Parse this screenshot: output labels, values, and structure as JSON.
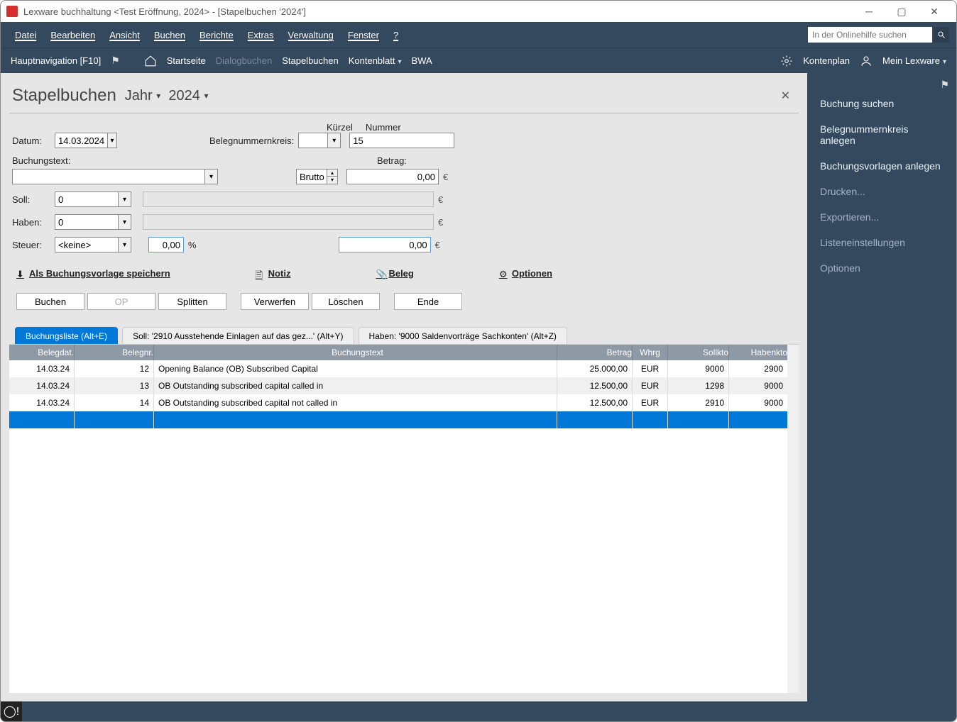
{
  "window": {
    "title": "Lexware buchhaltung <Test Eröffnung, 2024> - [Stapelbuchen '2024']"
  },
  "menubar": {
    "items": [
      "Datei",
      "Bearbeiten",
      "Ansicht",
      "Buchen",
      "Berichte",
      "Extras",
      "Verwaltung",
      "Fenster",
      "?"
    ],
    "search_placeholder": "In der Onlinehilfe suchen"
  },
  "navbar": {
    "hauptnav": "Hauptnavigation [F10]",
    "crumbs": [
      "Startseite",
      "Dialogbuchen",
      "Stapelbuchen",
      "Kontenblatt",
      "BWA"
    ],
    "kontenplan": "Kontenplan",
    "mein": "Mein Lexware"
  },
  "rightpanel": {
    "items": [
      {
        "t": "Buchung suchen",
        "dim": false
      },
      {
        "t": "Belegnummernkreis anlegen",
        "dim": false
      },
      {
        "t": "Buchungsvorlagen anlegen",
        "dim": false
      },
      {
        "t": "Drucken...",
        "dim": true
      },
      {
        "t": "Exportieren...",
        "dim": true
      },
      {
        "t": "Listeneinstellungen",
        "dim": true
      },
      {
        "t": "Optionen",
        "dim": true
      }
    ]
  },
  "page": {
    "title": "Stapelbuchen",
    "year_lbl": "Jahr",
    "year": "2024",
    "labels": {
      "datum": "Datum:",
      "belegnrkreis": "Belegnummernkreis:",
      "kuerzel": "Kürzel",
      "nummer": "Nummer",
      "buchungstext": "Buchungstext:",
      "betrag": "Betrag:",
      "brutto": "Brutto",
      "soll": "Soll:",
      "haben": "Haben:",
      "steuer": "Steuer:",
      "percent": "%",
      "euro": "€",
      "vorlage": "Als Buchungsvorlage speichern",
      "notiz": "Notiz",
      "beleg": "Beleg",
      "optionen": "Optionen"
    },
    "values": {
      "datum": "14.03.2024",
      "nummer": "15",
      "betrag": "0,00",
      "soll": "0",
      "haben": "0",
      "steuer": "<keine>",
      "steuer_pct": "0,00",
      "calc": "0,00"
    },
    "buttons": {
      "buchen": "Buchen",
      "op": "OP",
      "splitten": "Splitten",
      "verwerfen": "Verwerfen",
      "loeschen": "Löschen",
      "ende": "Ende"
    },
    "tabs": [
      "Buchungsliste (Alt+E)",
      "Soll: '2910 Ausstehende Einlagen auf das gez...' (Alt+Y)",
      "Haben: '9000 Saldenvorträge Sachkonten' (Alt+Z)"
    ],
    "table": {
      "headers": [
        "Belegdat.",
        "Belegnr.",
        "Buchungstext",
        "Betrag",
        "Whrg",
        "Sollkto",
        "Habenkto"
      ],
      "rows": [
        {
          "d": "14.03.24",
          "n": "12",
          "t": "Opening Balance (OB) Subscribed Capital",
          "a": "25.000,00",
          "w": "EUR",
          "s": "9000",
          "h": "2900"
        },
        {
          "d": "14.03.24",
          "n": "13",
          "t": "OB Outstanding subscribed capital called in",
          "a": "12.500,00",
          "w": "EUR",
          "s": "1298",
          "h": "9000"
        },
        {
          "d": "14.03.24",
          "n": "14",
          "t": "OB Outstanding subscribed capital not called in",
          "a": "12.500,00",
          "w": "EUR",
          "s": "2910",
          "h": "9000"
        }
      ]
    }
  }
}
